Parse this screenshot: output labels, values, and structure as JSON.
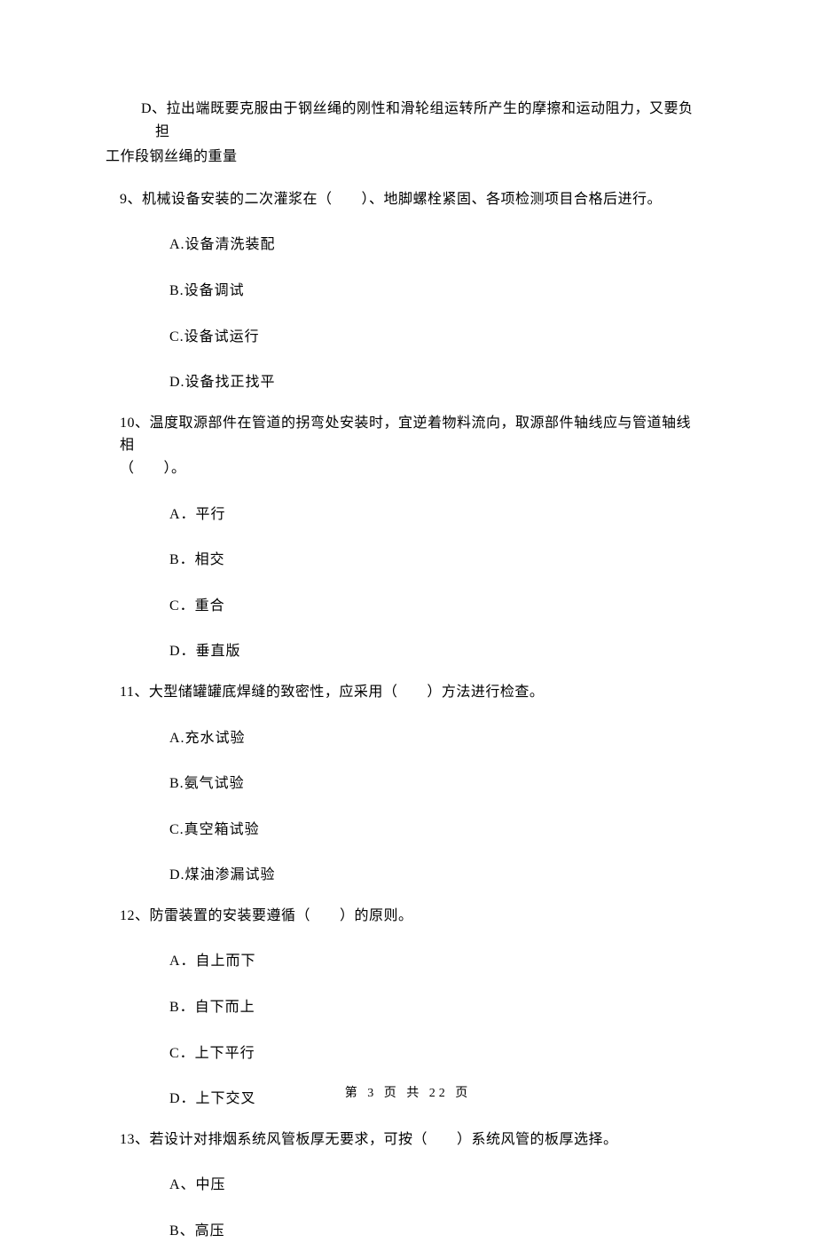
{
  "continuation": {
    "optionD_line1": "D、拉出端既要克服由于钢丝绳的刚性和滑轮组运转所产生的摩擦和运动阻力，又要负担",
    "optionD_line2": "工作段钢丝绳的重量"
  },
  "q9": {
    "stem": "9、机械设备安装的二次灌浆在（　　）、地脚螺栓紧固、各项检测项目合格后进行。",
    "a": "A.设备清洗装配",
    "b": "B.设备调试",
    "c": "C.设备试运行",
    "d": "D.设备找正找平"
  },
  "q10": {
    "stem_line1": "10、温度取源部件在管道的拐弯处安装时，宜逆着物料流向，取源部件轴线应与管道轴线相",
    "stem_line2": "（　　）。",
    "a": "A．平行",
    "b": "B．相交",
    "c": "C．重合",
    "d": "D．垂直版"
  },
  "q11": {
    "stem": "11、大型储罐罐底焊缝的致密性，应采用（　　）方法进行检查。",
    "a": "A.充水试验",
    "b": "B.氨气试验",
    "c": "C.真空箱试验",
    "d": "D.煤油渗漏试验"
  },
  "q12": {
    "stem": "12、防雷装置的安装要遵循（　　）的原则。",
    "a": "A．自上而下",
    "b": "B．自下而上",
    "c": "C．上下平行",
    "d": "D．上下交叉"
  },
  "q13": {
    "stem": "13、若设计对排烟系统风管板厚无要求，可按（　　）系统风管的板厚选择。",
    "a": "A、中压",
    "b": "B、高压"
  },
  "footer": {
    "text": "第 3 页 共 22 页"
  }
}
